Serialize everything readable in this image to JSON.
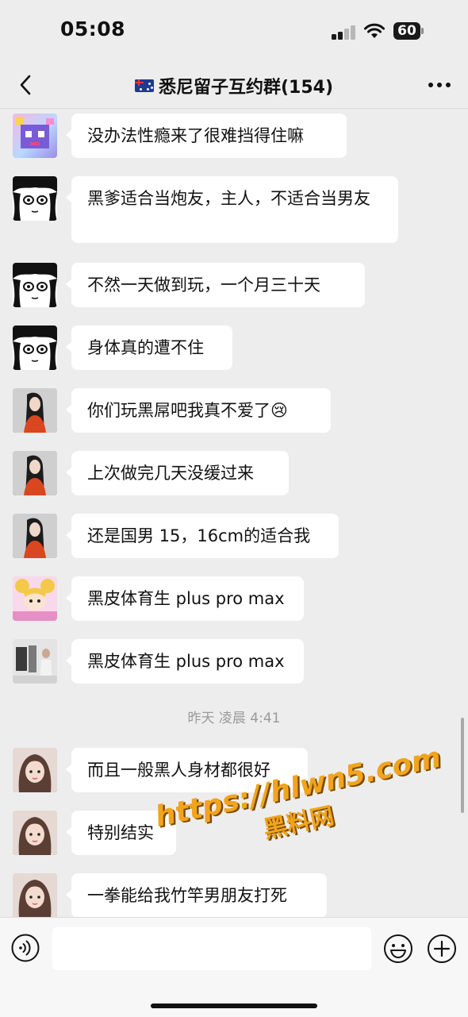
{
  "status_bar": {
    "time": "05:08",
    "battery": "60"
  },
  "nav": {
    "title": "悉尼留子互约群(154)",
    "flag_icon": "australia-flag-icon"
  },
  "messages": [
    {
      "avatar": "pixel-art-avatar",
      "text": "没办法性瘾来了很难挡得住嘛"
    },
    {
      "avatar": "manga-girl-avatar",
      "text": "黑爹适合当炮友，主人，不适合当男友"
    },
    {
      "avatar": "manga-girl-avatar",
      "text": "不然一天做到玩，一个月三十天"
    },
    {
      "avatar": "manga-girl-avatar",
      "text": "身体真的遭不住"
    },
    {
      "avatar": "long-hair-girl-avatar",
      "text": "你们玩黑屌吧我真不爱了😢"
    },
    {
      "avatar": "long-hair-girl-avatar",
      "text": "上次做完几天没缓过来"
    },
    {
      "avatar": "long-hair-girl-avatar",
      "text": "还是国男 15，16cm的适合我"
    },
    {
      "avatar": "sailor-moon-avatar",
      "text": "黑皮体育生 plus pro max"
    },
    {
      "avatar": "room-photo-avatar",
      "text": "黑皮体育生 plus pro max"
    },
    {
      "avatar": "selfie-girl-avatar",
      "text": "而且一般黑人身材都很好"
    },
    {
      "avatar": "selfie-girl-avatar",
      "text": "特别结实"
    },
    {
      "avatar": "selfie-girl-avatar",
      "text": "一拳能给我竹竿男朋友打死"
    }
  ],
  "timestamp": "昨天 凌晨 4:41",
  "watermark": {
    "line1": "https://hlwn5.com",
    "line2": "黑料网"
  },
  "input": {
    "placeholder": ""
  }
}
